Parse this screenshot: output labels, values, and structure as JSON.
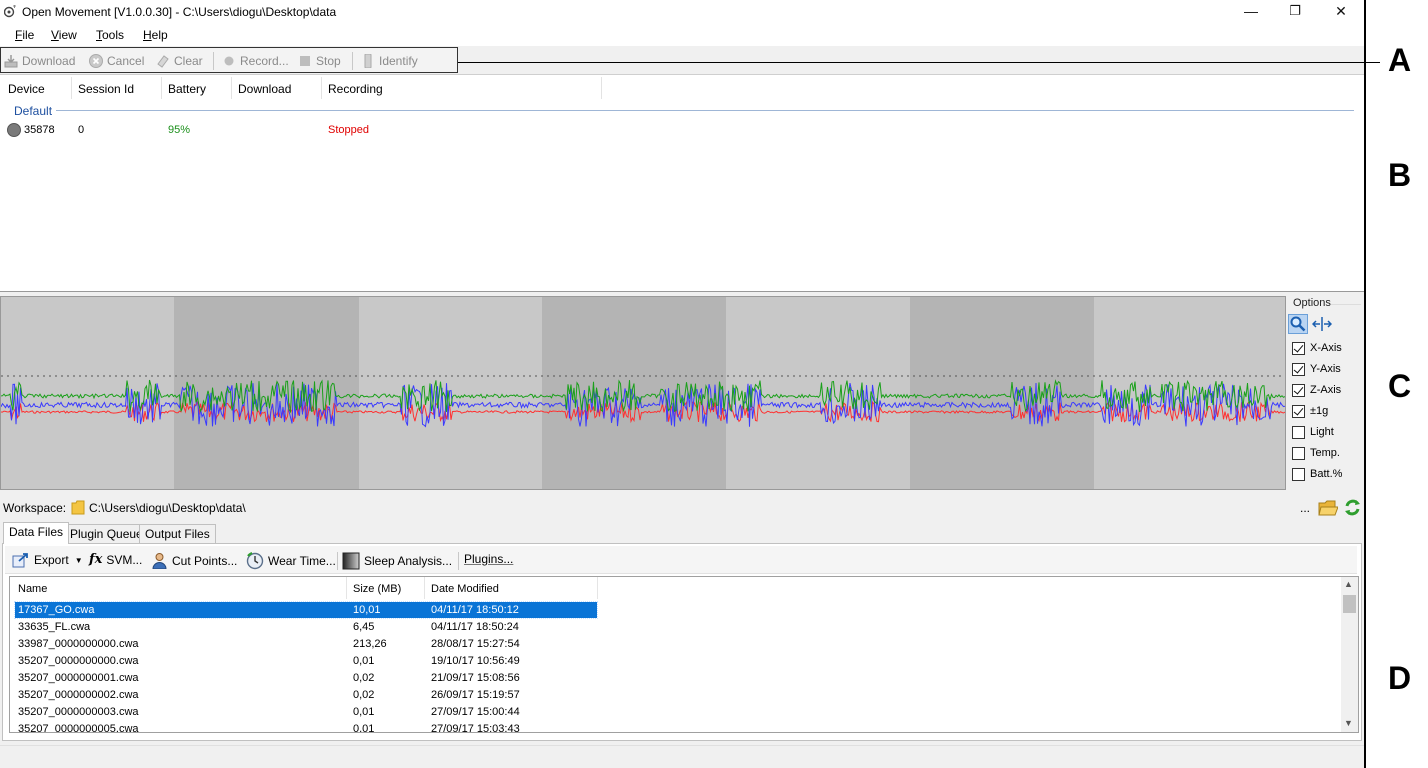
{
  "window": {
    "title": "Open Movement  [V1.0.0.30] - C:\\Users\\diogu\\Desktop\\data",
    "minimize": "—",
    "restore": "❐",
    "close": "✕"
  },
  "menu": [
    {
      "label": "File",
      "accel": "F",
      "rest": "ile"
    },
    {
      "label": "View",
      "accel": "V",
      "rest": "iew"
    },
    {
      "label": "Tools",
      "accel": "T",
      "rest": "ools"
    },
    {
      "label": "Help",
      "accel": "H",
      "rest": "elp"
    }
  ],
  "toolbar": {
    "download": "Download",
    "cancel": "Cancel",
    "clear": "Clear",
    "record": "Record...",
    "stop": "Stop",
    "identify": "Identify"
  },
  "annotations": {
    "a": "A",
    "b": "B",
    "c": "C",
    "d": "D"
  },
  "devices": {
    "columns": [
      "Device",
      "Session Id",
      "Battery",
      "Download",
      "Recording"
    ],
    "group": "Default",
    "rows": [
      {
        "device": "35878",
        "session": "0",
        "battery": "95%",
        "download": "",
        "recording": "Stopped"
      }
    ],
    "battery_color": "#1a8f1a",
    "recording_color": "#e00000"
  },
  "graph": {
    "series_colors": {
      "x": "#ff3030",
      "y": "#3a3aff",
      "z": "#1aa01a"
    },
    "shading": [
      "#c8c8c8",
      "#b4b4b4"
    ]
  },
  "options": {
    "title": "Options",
    "zoom_icon": "magnifier-icon",
    "pan_icon": "pan-icon",
    "items": [
      {
        "label": "X-Axis",
        "checked": true
      },
      {
        "label": "Y-Axis",
        "checked": true
      },
      {
        "label": "Z-Axis",
        "checked": true
      },
      {
        "label": "±1g",
        "checked": true
      },
      {
        "label": "Light",
        "checked": false
      },
      {
        "label": "Temp.",
        "checked": false
      },
      {
        "label": "Batt.%",
        "checked": false
      }
    ]
  },
  "workspace": {
    "label": "Workspace:",
    "path": "C:\\Users\\diogu\\Desktop\\data\\",
    "browse": "..."
  },
  "tabs": [
    "Data Files",
    "Plugin Queue",
    "Output Files"
  ],
  "actions": {
    "export": "Export",
    "svm": "SVM...",
    "cut_points": "Cut Points...",
    "wear_time": "Wear Time...",
    "sleep": "Sleep Analysis...",
    "plugins": "Plugins..."
  },
  "files": {
    "columns": [
      "Name",
      "Size (MB)",
      "Date Modified"
    ],
    "rows": [
      {
        "name": "17367_GO.cwa",
        "size": "10,01",
        "date": "04/11/17 18:50:12",
        "selected": true
      },
      {
        "name": "33635_FL.cwa",
        "size": "6,45",
        "date": "04/11/17 18:50:24",
        "selected": false
      },
      {
        "name": "33987_0000000000.cwa",
        "size": "213,26",
        "date": "28/08/17 15:27:54",
        "selected": false
      },
      {
        "name": "35207_0000000000.cwa",
        "size": "0,01",
        "date": "19/10/17 10:56:49",
        "selected": false
      },
      {
        "name": "35207_0000000001.cwa",
        "size": "0,02",
        "date": "21/09/17 15:08:56",
        "selected": false
      },
      {
        "name": "35207_0000000002.cwa",
        "size": "0,02",
        "date": "26/09/17 15:19:57",
        "selected": false
      },
      {
        "name": "35207_0000000003.cwa",
        "size": "0,01",
        "date": "27/09/17 15:00:44",
        "selected": false
      },
      {
        "name": "35207_0000000005.cwa",
        "size": "0,01",
        "date": "27/09/17 15:03:43",
        "selected": false
      }
    ]
  }
}
